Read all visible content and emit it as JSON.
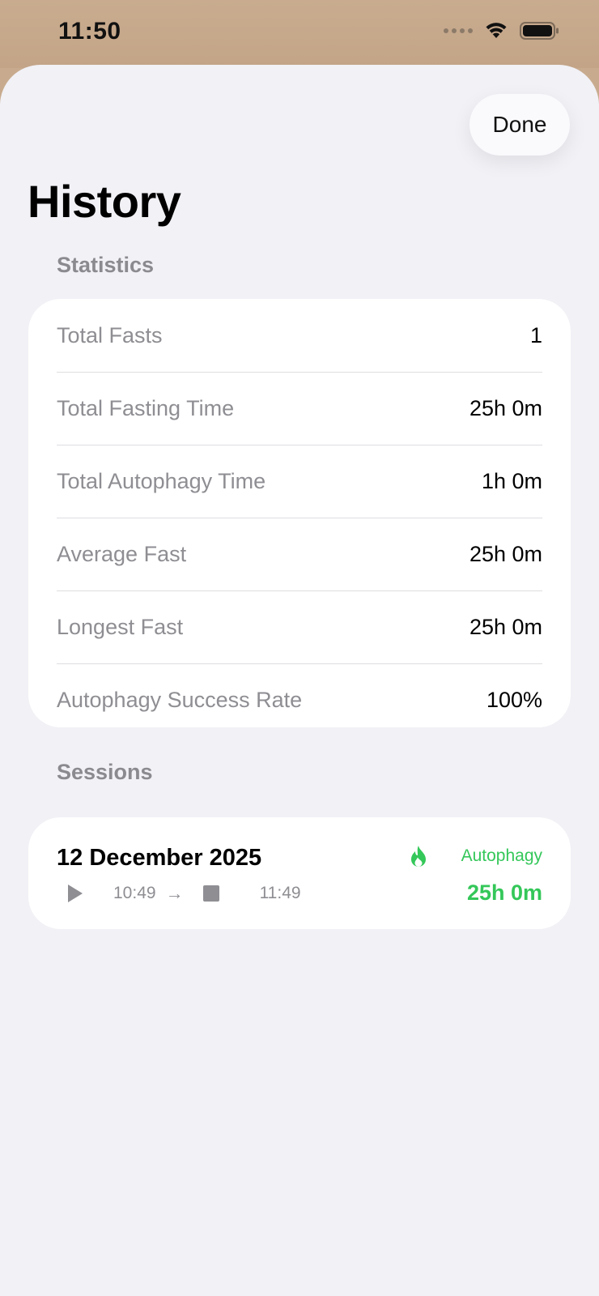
{
  "status_bar": {
    "time": "11:50"
  },
  "header": {
    "done_label": "Done",
    "title": "History"
  },
  "statistics": {
    "header": "Statistics",
    "rows": [
      {
        "label": "Total Fasts",
        "value": "1"
      },
      {
        "label": "Total Fasting Time",
        "value": "25h 0m"
      },
      {
        "label": "Total Autophagy Time",
        "value": "1h 0m"
      },
      {
        "label": "Average Fast",
        "value": "25h 0m"
      },
      {
        "label": "Longest Fast",
        "value": "25h 0m"
      },
      {
        "label": "Autophagy Success Rate",
        "value": "100%"
      }
    ]
  },
  "sessions": {
    "header": "Sessions",
    "items": [
      {
        "date": "12 December 2025",
        "start_time": "10:49",
        "end_time": "11:49",
        "status": "Autophagy",
        "duration": "25h 0m",
        "status_icon": "flame-icon"
      }
    ]
  },
  "colors": {
    "accent_green": "#34c759",
    "background": "#f1f1f6",
    "status_bar_bg": "#c8ab8e",
    "secondary_text": "#8e8e93"
  }
}
